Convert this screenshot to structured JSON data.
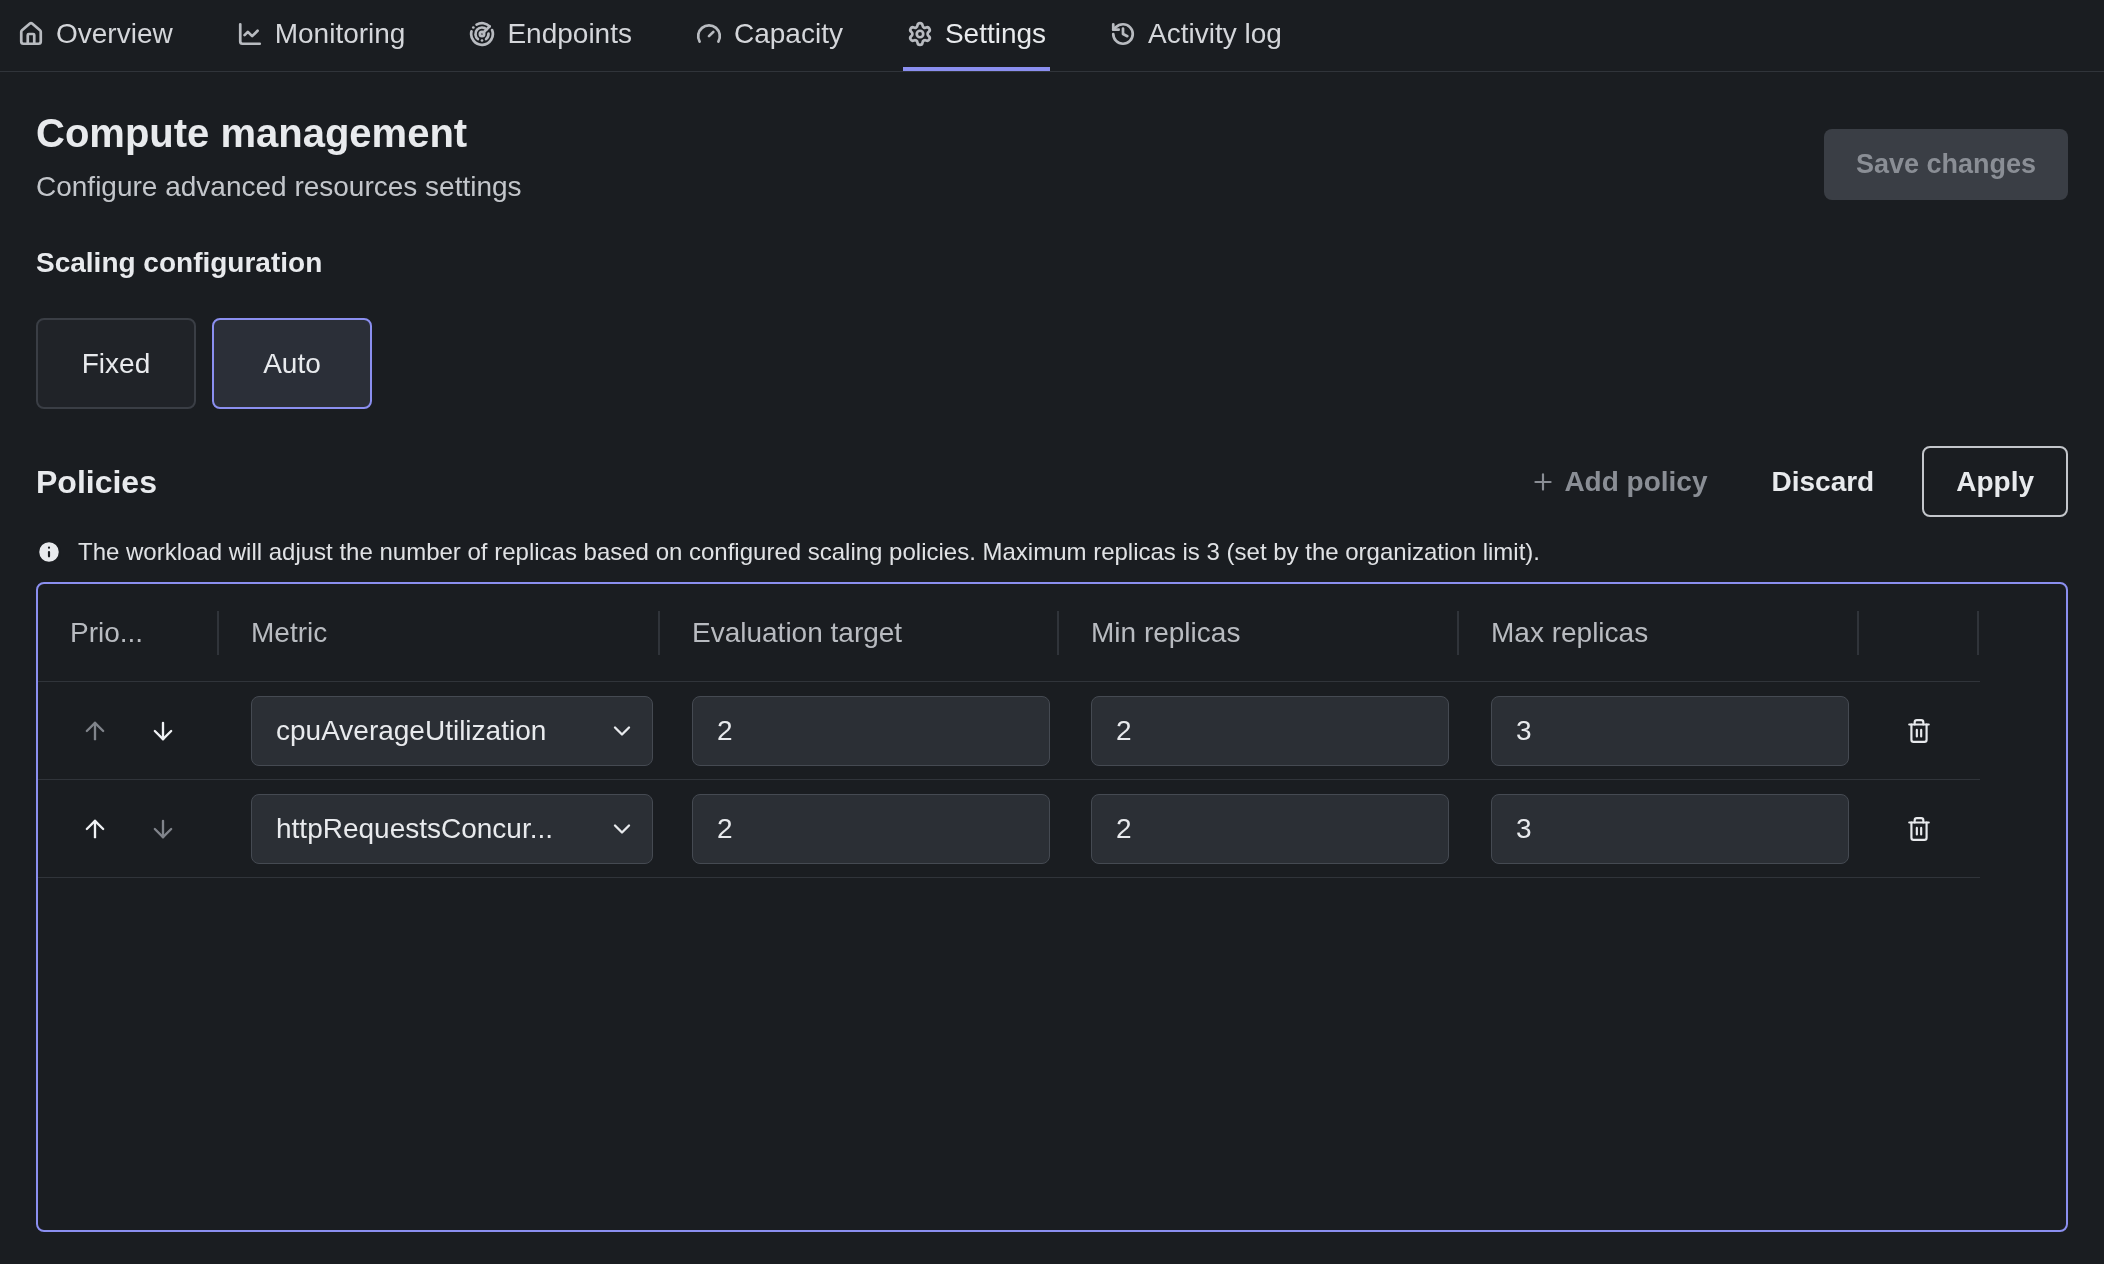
{
  "tabs": [
    {
      "label": "Overview",
      "selected": false
    },
    {
      "label": "Monitoring",
      "selected": false
    },
    {
      "label": "Endpoints",
      "selected": false
    },
    {
      "label": "Capacity",
      "selected": false
    },
    {
      "label": "Settings",
      "selected": true
    },
    {
      "label": "Activity log",
      "selected": false
    }
  ],
  "header": {
    "title": "Compute management",
    "subtitle": "Configure advanced resources settings",
    "save_button": {
      "label": "Save changes",
      "disabled": true
    }
  },
  "scaling": {
    "title": "Scaling configuration",
    "options": [
      {
        "label": "Fixed",
        "selected": false
      },
      {
        "label": "Auto",
        "selected": true
      }
    ]
  },
  "policies": {
    "title": "Policies",
    "add_button": {
      "label": "Add policy",
      "disabled": true
    },
    "discard_button": "Discard",
    "apply_button": "Apply",
    "info": "The workload will adjust the number of replicas based on configured scaling policies. Maximum replicas is 3 (set by the organization limit).",
    "table": {
      "columns": [
        "Prio...",
        "Metric",
        "Evaluation target",
        "Min replicas",
        "Max replicas"
      ],
      "rows": [
        {
          "up_disabled": true,
          "down_disabled": false,
          "metric": "cpuAverageUtilization",
          "evaluation_target": "2",
          "min_replicas": "2",
          "max_replicas": "3"
        },
        {
          "up_disabled": false,
          "down_disabled": true,
          "metric": "httpRequestsConcur...",
          "evaluation_target": "2",
          "min_replicas": "2",
          "max_replicas": "3"
        }
      ]
    }
  }
}
